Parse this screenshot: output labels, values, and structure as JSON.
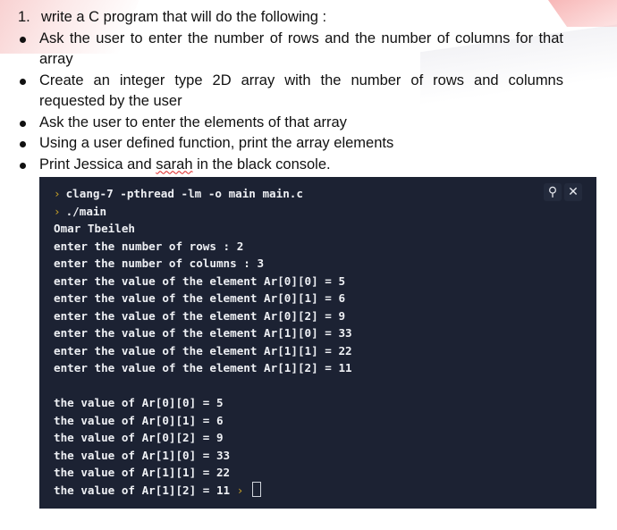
{
  "assignment": {
    "number": "1.",
    "heading": "write a C program that will do the following :",
    "bullets": [
      "Ask the user to enter the number of rows and the number of columns for that array",
      "Create an integer type 2D array with the number of rows and columns requested by the user",
      "Ask the user to enter the elements of that array",
      "Using a user defined function, print the array elements"
    ],
    "last_bullet": {
      "before": "Print Jessica and ",
      "misspelled": "sarah",
      "after": " in the black console."
    }
  },
  "console": {
    "colors": {
      "background": "#1c2233",
      "text": "#eef0f4",
      "prompt": "#c9a227"
    },
    "prompt_symbol": "›",
    "commands": [
      "clang-7 -pthread -lm -o main main.c",
      "./main"
    ],
    "output": [
      "Omar Tbeileh",
      "enter the number of rows : 2",
      "enter the number of columns : 3",
      "enter the value of the element Ar[0][0] = 5",
      "enter the value of the element Ar[0][1] = 6",
      "enter the value of the element Ar[0][2] = 9",
      "enter the value of the element Ar[1][0] = 33",
      "enter the value of the element Ar[1][1] = 22",
      "enter the value of the element Ar[1][2] = 11",
      "",
      "the value of Ar[0][0] = 5",
      "the value of Ar[0][1] = 6",
      "the value of Ar[0][2] = 9",
      "the value of Ar[1][0] = 33",
      "the value of Ar[1][1] = 22"
    ],
    "last_line": "the value of Ar[1][2] = 11",
    "tools": {
      "search_icon": "⚲",
      "close_icon": "✕"
    }
  }
}
